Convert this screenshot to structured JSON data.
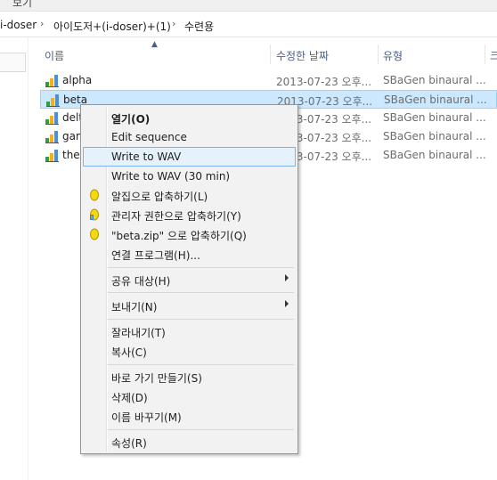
{
  "window": {
    "top_text": "보기"
  },
  "breadcrumb": {
    "items": [
      "i-doser",
      "아이도저+(i-doser)+(1)",
      "수련용"
    ]
  },
  "columns": {
    "name": "이름",
    "modified": "수정한 날짜",
    "type": "유형",
    "size": "크"
  },
  "files": [
    {
      "name": "alpha",
      "date": "2013-07-23 오후...",
      "type": "SBaGen binaural ..."
    },
    {
      "name": "beta",
      "date": "2013-07-23 오후...",
      "type": "SBaGen binaural ..."
    },
    {
      "name": "delt",
      "date": "2013-07-23 오후...",
      "type": "SBaGen binaural ..."
    },
    {
      "name": "gam",
      "date": "2013-07-23 오후...",
      "type": "SBaGen binaural ..."
    },
    {
      "name": "thet",
      "date": "2013-07-23 오후...",
      "type": "SBaGen binaural ..."
    }
  ],
  "selected_file": "beta",
  "context_menu": {
    "open": "열기(O)",
    "edit_sequence": "Edit sequence",
    "write_wav": "Write to WAV",
    "write_wav_30": "Write to WAV (30 min)",
    "compress_alzip": "알집으로 압축하기(L)",
    "compress_admin": "관리자 권한으로 압축하기(Y)",
    "compress_zip": "\"beta.zip\" 으로 압축하기(Q)",
    "open_with": "연결 프로그램(H)...",
    "share_with": "공유 대상(H)",
    "send_to": "보내기(N)",
    "cut": "잘라내기(T)",
    "copy": "복사(C)",
    "create_shortcut": "바로 가기 만들기(S)",
    "delete": "삭제(D)",
    "rename": "이름 바꾸기(M)",
    "properties": "속성(R)"
  },
  "colors": {
    "selection_bg": "#cce8ff",
    "menu_highlight": "#e5f1fb",
    "header_text": "#4d6082"
  }
}
